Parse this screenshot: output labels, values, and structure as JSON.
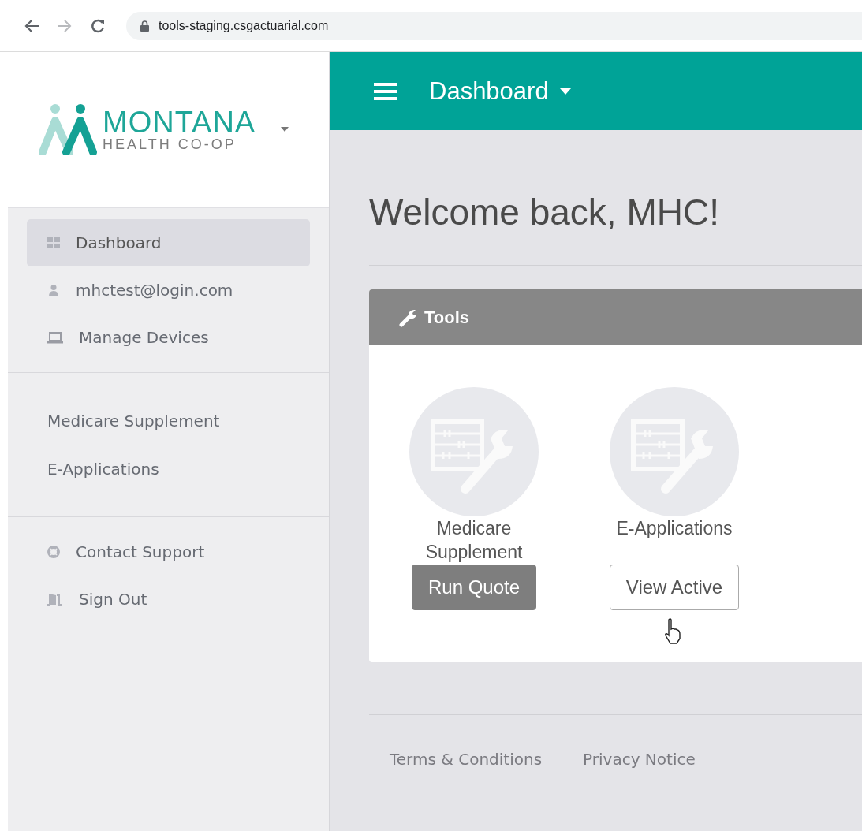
{
  "browser": {
    "url": "tools-staging.csgactuarial.com"
  },
  "logo": {
    "name": "MONTANA",
    "tagline": "HEALTH CO-OP"
  },
  "sidebar": {
    "sections": [
      {
        "items": [
          {
            "label": "Dashboard",
            "selected": true
          },
          {
            "label": "mhctest@login.com",
            "selected": false
          },
          {
            "label": "Manage Devices",
            "selected": false
          }
        ]
      },
      {
        "items": [
          {
            "label": "Medicare Supplement",
            "selected": false
          },
          {
            "label": "E-Applications",
            "selected": false
          }
        ]
      },
      {
        "items": [
          {
            "label": "Contact Support",
            "selected": false
          },
          {
            "label": "Sign Out",
            "selected": false
          }
        ]
      }
    ]
  },
  "header": {
    "title": "Dashboard"
  },
  "welcome": "Welcome back, MHC!",
  "tools_panel": {
    "title": "Tools",
    "tools": [
      {
        "name": "Medicare Supplement",
        "button": {
          "label": "Run Quote",
          "kind": "filled"
        }
      },
      {
        "name": "E-Applications",
        "button": {
          "label": "View Active",
          "kind": "outline"
        }
      }
    ]
  },
  "footer": {
    "links": [
      "Terms & Conditions",
      "Privacy Notice"
    ]
  }
}
